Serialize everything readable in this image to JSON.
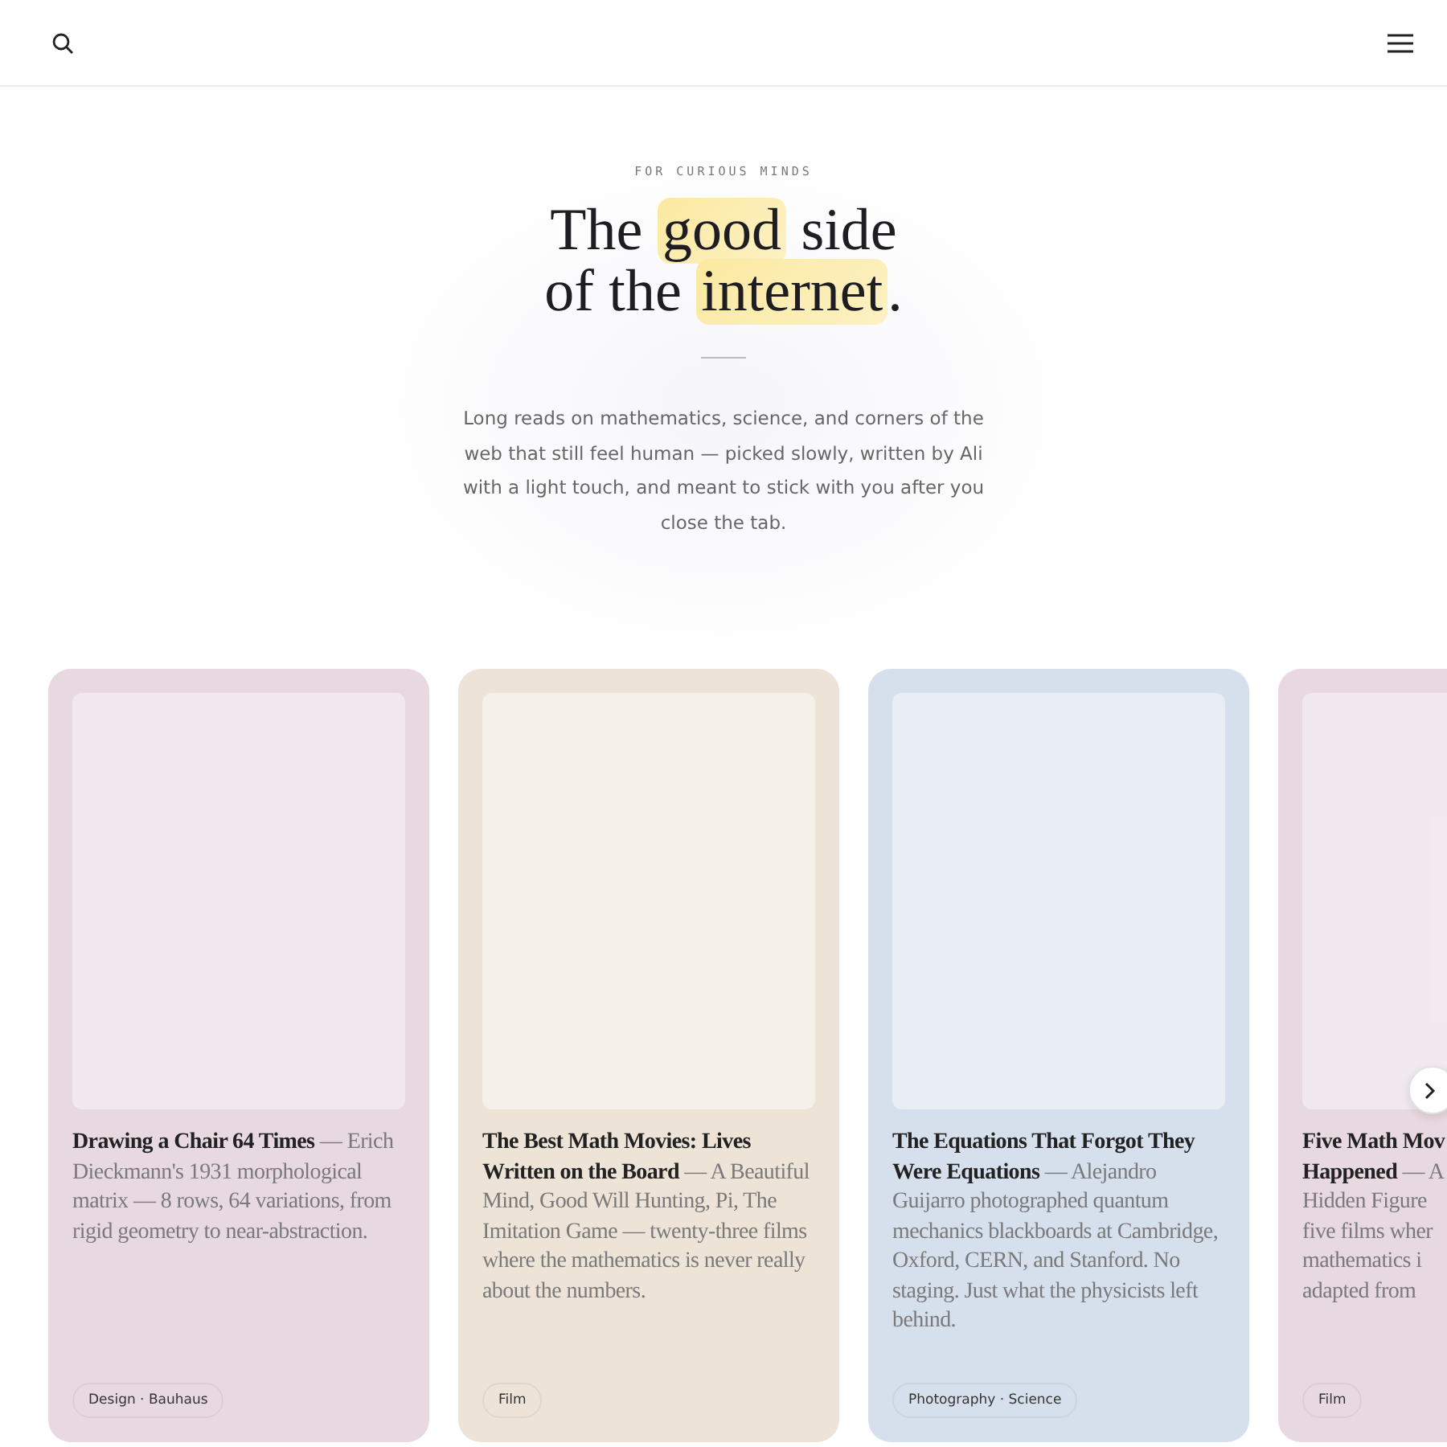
{
  "eyebrow": "FOR CURIOUS MINDS",
  "heading": [
    [
      {
        "text": "The ",
        "highlight": false
      },
      {
        "text": "good",
        "highlight": true
      },
      {
        "text": " side",
        "highlight": false
      }
    ],
    [
      {
        "text": "of the ",
        "highlight": false
      },
      {
        "text": "internet",
        "highlight": true
      },
      {
        "text": ".",
        "highlight": false
      }
    ]
  ],
  "intro": "Long reads on mathematics, science, and corners of the web that still feel human — picked slowly, written by Ali with a light touch, and meant to stick with you after you close the tab.",
  "cards": [
    {
      "title": "Drawing a Chair 64 Times",
      "description": "— Erich Dieckmann's 1931 morphological matrix — 8 rows, 64 variations, from rigid geometry to near-abstraction.",
      "tag": "Design · Bauhaus",
      "color": "#e8d8e0"
    },
    {
      "title": "The Best Math Movies: Lives Written on the Board",
      "description": "— A Beautiful Mind, Good Will Hunting, Pi, The Imitation Game — twenty-three films where the mathematics is never really about the numbers.",
      "tag": "Film",
      "color": "#ede3d7"
    },
    {
      "title": "The Equations That Forgot They Were Equations",
      "description": "— Alejandro Guijarro photographed quantum mechanics blackboards at Cambridge, Oxford, CERN, and Stanford. No staging. Just what the physicists left behind.",
      "tag": "Photography · Science",
      "color": "#d5e0ec"
    },
    {
      "title": "Five Math Mov\nHappened",
      "description": "— A\nHidden Figure\nfive films wher\nmathematics i\nadapted from",
      "tag": "Film",
      "color": "#e8d8e0"
    }
  ]
}
